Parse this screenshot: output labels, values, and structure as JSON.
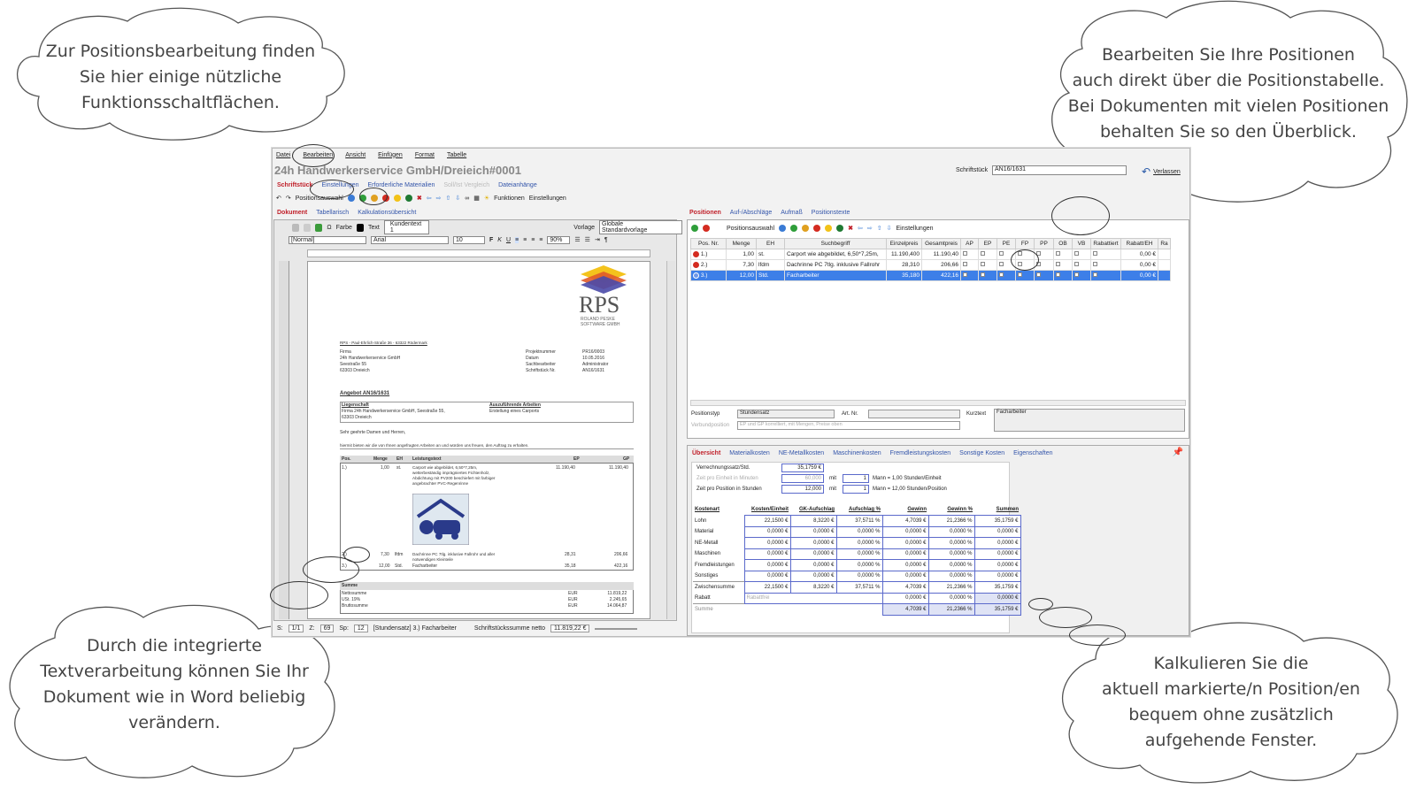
{
  "callouts": {
    "top_left": "Zur Positionsbearbeitung finden\nSie hier einige nützliche\nFunktionsschaltflächen.",
    "top_right": "Bearbeiten Sie Ihre Positionen\nauch direkt über die Positionstabelle.\nBei Dokumenten mit vielen Positionen\nbehalten Sie so den Überblick.",
    "bottom_left": "Durch die integrierte\nTextverarbeitung können Sie Ihr\nDokument wie in Word beliebig\nverändern.",
    "bottom_right": "Kalkulieren Sie die\naktuell markierte/n Position/en\nbequem ohne zusätzlich\naufgehende Fenster."
  },
  "menu": [
    "Datei",
    "Bearbeiten",
    "Ansicht",
    "Einfügen",
    "Format",
    "Tabelle"
  ],
  "window": {
    "title": "24h Handwerkerservice GmbH/Dreieich#0001",
    "doc_label": "Schriftstück",
    "doc_value": "AN16/1631",
    "leave_label": "Verlassen"
  },
  "main_tabs": [
    {
      "label": "Schriftstück",
      "state": "active"
    },
    {
      "label": "Einstellungen",
      "state": "normal"
    },
    {
      "label": "Erforderliche Materialien",
      "state": "normal"
    },
    {
      "label": "Soll/Ist Vergleich",
      "state": "disabled"
    },
    {
      "label": "Dateianhänge",
      "state": "normal"
    }
  ],
  "toolbar": {
    "positions_label": "Positionsauswahl",
    "functions_label": "Funktionen",
    "settings_label": "Einstellungen"
  },
  "left_tabs": [
    {
      "label": "Dokument",
      "state": "active"
    },
    {
      "label": "Tabellarisch",
      "state": "normal"
    },
    {
      "label": "Kalkulationsübersicht",
      "state": "normal"
    }
  ],
  "editor": {
    "color_label": "Farbe",
    "text_label": "Text",
    "text_value": "Kundentext 1",
    "template_label": "Vorlage",
    "template_value": "Globale Standardvorlage",
    "style_value": "[Normal]",
    "font_value": "Arial",
    "size_value": "10",
    "zoom_value": "90%"
  },
  "letter": {
    "logo": "RPS",
    "logo_sub": "ROLAND PESKE\nSOFTWARE GMBH",
    "sender_line": "RPS - Paul-Ehrlich-Straße 36 - 63322 Rödermark",
    "address": "Firma\n24h Handwerkerservice GmbH\nSeestraße 55\n63303 Dreieich",
    "meta_labels": "Projektnummer\nDatum\nSachbearbeiter\nSchriftstück Nr.",
    "meta_values": "PR16/0003\n10.05.2016\nAdministrator\nAN16/1631",
    "heading": "Angebot AN16/1631",
    "property_label": "Liegenschaft",
    "property_value": "Firma 24h Handwerkerservice GmbH, Seestraße 55,\n63303 Dreieich",
    "work_label": "Auszuführende Arbeiten",
    "work_value": "Erstellung eines Carports",
    "greeting": "Sehr geehrte Damen und Herren,",
    "intro": "hiermit bieten wir die von Ihnen angefragten Arbeiten an und würden uns freuen, den Auftrag zu erhalten.",
    "table_head": [
      "Pos.",
      "Menge",
      "EH",
      "Leistungstext",
      "EP",
      "GP"
    ],
    "rows": [
      {
        "pos": "1.)",
        "qty": "1,00",
        "unit": "st.",
        "text": "Carport wie abgebildet, 6,50*7,25m,\nwetterbeständig imprägniertes Fichtenholz,\nAbdichtung mit PV200 beschiefert mit farbiger\nangebrachter PVC-Regenrinne",
        "ep": "11.190,40",
        "gp": "11.190,40"
      },
      {
        "pos": "2.)",
        "qty": "7,30",
        "unit": "lfdm",
        "text": "Dachrinne PC 7tlg. inklusive Fallrohr und aller\nnotwendigen Kleinteile",
        "ep": "28,31",
        "gp": "206,66"
      },
      {
        "pos": "3.)",
        "qty": "12,00",
        "unit": "Std.",
        "text": "Facharbeiter",
        "ep": "35,18",
        "gp": "422,16"
      }
    ],
    "sum_title": "Summe",
    "sum_labels": "Nettosumme\nUSt. 19%\nBruttosumme",
    "sum_currency": "EUR\nEUR\nEUR",
    "sum_values": "11.819,22\n2.245,65\n14.064,87"
  },
  "statusbar": {
    "s": "S:",
    "page": "1/1",
    "z": "Z:",
    "z_value": "69",
    "sp": "Sp:",
    "sp_value": "12",
    "position": "[Stundensatz] 3.) Facharbeiter",
    "sum_label": "Schriftstückssumme netto",
    "sum_value": "11.819,22 €"
  },
  "right_tabs": [
    {
      "label": "Positionen",
      "state": "active"
    },
    {
      "label": "Auf-/Abschläge",
      "state": "normal"
    },
    {
      "label": "Aufmaß",
      "state": "normal"
    },
    {
      "label": "Positionstexte",
      "state": "normal"
    }
  ],
  "positions": {
    "selection_label": "Positionsauswahl",
    "settings_label": "Einstellungen",
    "columns": [
      "Pos. Nr.",
      "Menge",
      "EH",
      "Suchbegriff",
      "Einzelpreis",
      "Gesamtpreis",
      "AP",
      "EP",
      "PE",
      "FP",
      "PP",
      "OB",
      "VB",
      "Rabattiert",
      "Rabatt/EH",
      "Ra"
    ],
    "rows": [
      {
        "nr": "1.)",
        "qty": "1,00",
        "unit": "st.",
        "search": "Carport wie abgebildet, 6,50*7,25m,",
        "ep": "11.190,400",
        "gp": "11.190,40",
        "rabatt": "0,00 €",
        "selected": false
      },
      {
        "nr": "2.)",
        "qty": "7,30",
        "unit": "lfdm",
        "search": "Dachrinne PC 7tlg. inklusive Fallrohr",
        "ep": "28,310",
        "gp": "206,66",
        "rabatt": "0,00 €",
        "selected": false
      },
      {
        "nr": "3.)",
        "qty": "12,00",
        "unit": "Std.",
        "search": "Facharbeiter",
        "ep": "35,180",
        "gp": "422,16",
        "rabatt": "0,00 €",
        "selected": true
      }
    ],
    "type_label": "Positionstyp",
    "type_value": "Stundensatz",
    "art_label": "Art. Nr.",
    "short_label": "Kurztext",
    "short_value": "Facharbeiter",
    "link_label": "Verbundposition",
    "link_value": "EP und GP korrelliert, mit Mengen, Preise oben"
  },
  "calc_tabs": [
    {
      "label": "Übersicht",
      "state": "active"
    },
    {
      "label": "Materialkosten",
      "state": "normal"
    },
    {
      "label": "NE-Metallkosten",
      "state": "normal"
    },
    {
      "label": "Maschinenkosten",
      "state": "normal"
    },
    {
      "label": "Fremdleistungskosten",
      "state": "normal"
    },
    {
      "label": "Sonstige Kosten",
      "state": "normal"
    },
    {
      "label": "Eigenschaften",
      "state": "normal"
    }
  ],
  "calc": {
    "rate_label": "Verrechnungssatz/Std.",
    "rate_value": "35,1759 €",
    "time_unit_label": "Zeit pro Einheit in Minuten",
    "time_unit_value": "60,000",
    "time_pos_label": "Zeit pro Position in Stunden",
    "time_pos_value": "12,000",
    "with": "mit",
    "men_value": "1",
    "men1_text": "Mann = 1,00 Stunden/Einheit",
    "men2_text": "Mann = 12,00 Stunden/Position",
    "headers": [
      "Kostenart",
      "Kosten/Einheit",
      "GK-Aufschlag",
      "Aufschlag %",
      "Gewinn",
      "Gewinn %",
      "Summen"
    ],
    "rows": [
      [
        "Lohn",
        "22,1500 €",
        "8,3220 €",
        "37,5711 %",
        "4,7039 €",
        "21,2366 %",
        "35,1759 €"
      ],
      [
        "Material",
        "0,0000 €",
        "0,0000 €",
        "0,0000 %",
        "0,0000 €",
        "0,0000 %",
        "0,0000 €"
      ],
      [
        "NE-Metall",
        "0,0000 €",
        "0,0000 €",
        "0,0000 %",
        "0,0000 €",
        "0,0000 %",
        "0,0000 €"
      ],
      [
        "Maschinen",
        "0,0000 €",
        "0,0000 €",
        "0,0000 %",
        "0,0000 €",
        "0,0000 %",
        "0,0000 €"
      ],
      [
        "Fremdleistungen",
        "0,0000 €",
        "0,0000 €",
        "0,0000 %",
        "0,0000 €",
        "0,0000 %",
        "0,0000 €"
      ],
      [
        "Sonstiges",
        "0,0000 €",
        "0,0000 €",
        "0,0000 %",
        "0,0000 €",
        "0,0000 %",
        "0,0000 €"
      ]
    ],
    "subtotal": [
      "Zwischensumme",
      "22,1500 €",
      "8,3220 €",
      "37,5711 %",
      "4,7039 €",
      "21,2366 %",
      "35,1759 €"
    ],
    "discount_label": "Rabatt",
    "discount_placeholder": "Rabattfrei",
    "discount_values": [
      "0,0000 €",
      "0,0000 %",
      "0,0000 €"
    ],
    "total_label": "Summe",
    "total_values": [
      "4,7039 €",
      "21,2366 %",
      "35,1759 €"
    ]
  },
  "colors": {
    "accent_red": "#c0202a",
    "link_blue": "#3355aa",
    "selection": "#3d7fe8",
    "field_border": "#5b6acb"
  }
}
